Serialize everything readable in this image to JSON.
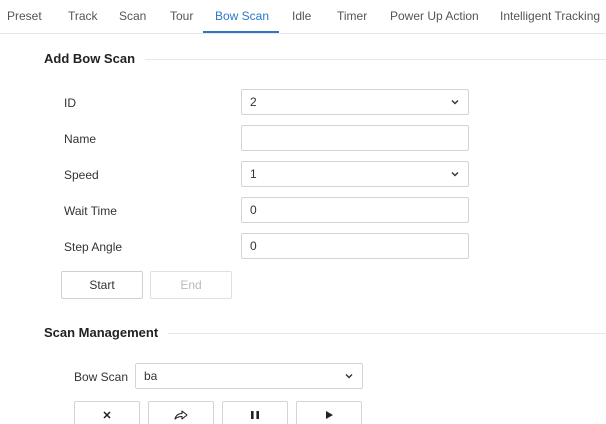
{
  "tabs": [
    {
      "label": "Preset"
    },
    {
      "label": "Track"
    },
    {
      "label": "Scan"
    },
    {
      "label": "Tour"
    },
    {
      "label": "Bow Scan"
    },
    {
      "label": "Idle"
    },
    {
      "label": "Timer"
    },
    {
      "label": "Power Up Action"
    },
    {
      "label": "Intelligent Tracking"
    }
  ],
  "active_tab": "Bow Scan",
  "accent_color": "#2d77c9",
  "add_bow_scan": {
    "title": "Add Bow Scan",
    "id": {
      "label": "ID",
      "value": "2"
    },
    "name": {
      "label": "Name",
      "value": ""
    },
    "speed": {
      "label": "Speed",
      "value": "1"
    },
    "wait_time": {
      "label": "Wait Time",
      "value": "0"
    },
    "step_angle": {
      "label": "Step Angle",
      "value": "0"
    },
    "start_label": "Start",
    "end_label": "End"
  },
  "scan_management": {
    "title": "Scan Management",
    "bow_scan_label": "Bow Scan",
    "bow_scan_value": "ba",
    "controls": [
      "delete-icon",
      "share-arrow-icon",
      "pause-icon",
      "play-icon"
    ]
  }
}
